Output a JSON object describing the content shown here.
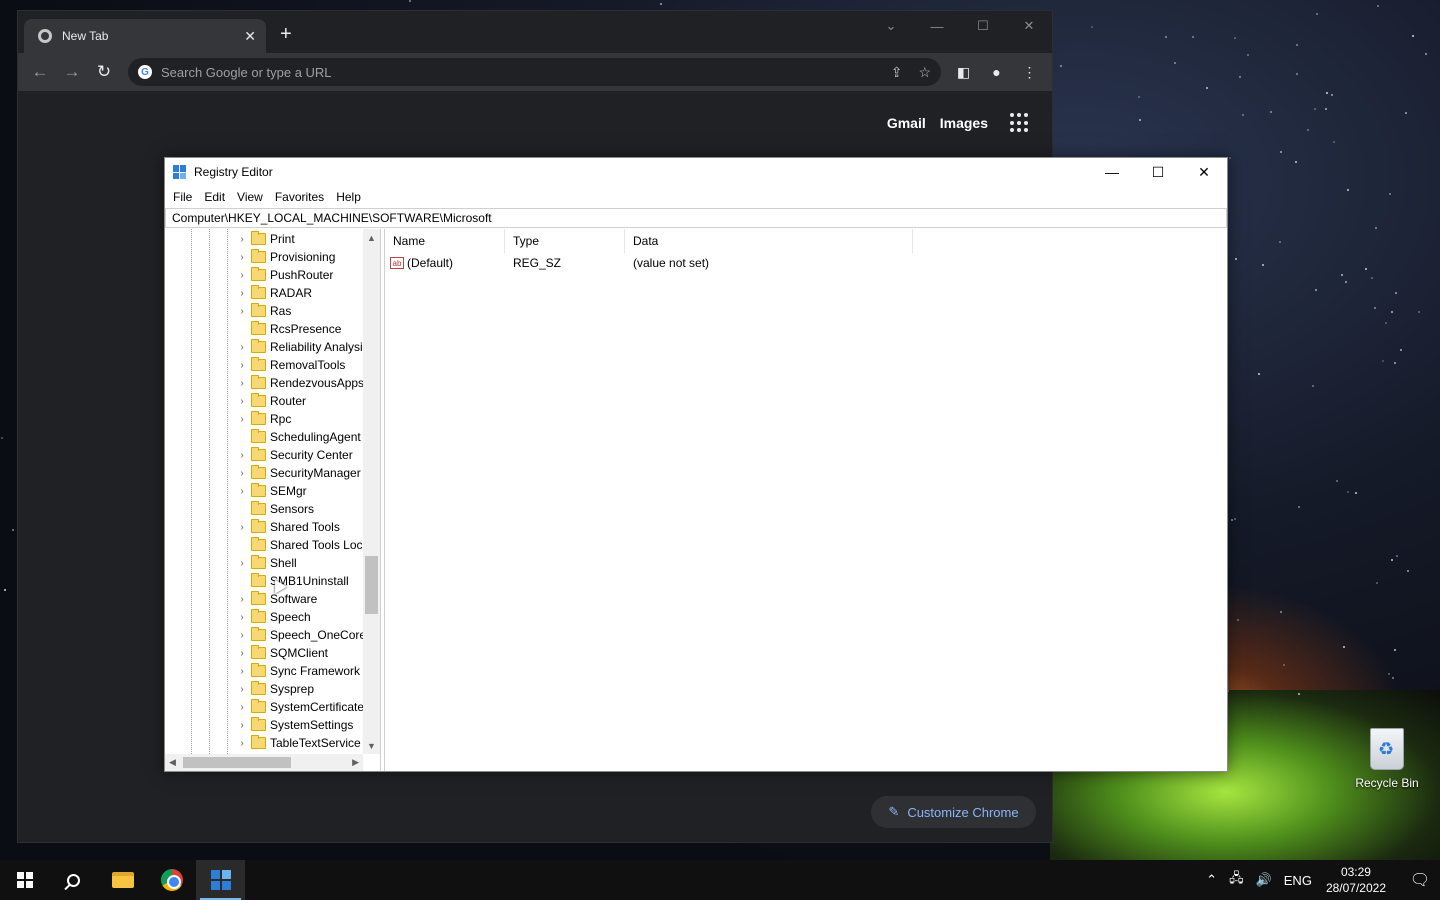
{
  "desktop": {
    "recycle_bin_label": "Recycle Bin"
  },
  "chrome": {
    "tab_title": "New Tab",
    "tab_close": "✕",
    "new_tab": "+",
    "omnibox_placeholder": "Search Google or type a URL",
    "top_links": [
      "Gmail",
      "Images"
    ],
    "customize_label": "Customize Chrome",
    "icons": {
      "favicon": "chrome-favicon-icon",
      "back": "arrow-left-icon",
      "forward": "arrow-right-icon",
      "reload": "reload-icon",
      "share": "share-icon",
      "bookmark": "star-icon",
      "side_panel": "side-panel-icon",
      "profile": "profile-icon",
      "menu": "kebab-menu-icon",
      "apps": "apps-grid-icon",
      "customize": "pencil-icon"
    }
  },
  "regedit": {
    "title": "Registry Editor",
    "menu": [
      "File",
      "Edit",
      "View",
      "Favorites",
      "Help"
    ],
    "address": "Computer\\HKEY_LOCAL_MACHINE\\SOFTWARE\\Microsoft",
    "tree_items": [
      {
        "label": "Print",
        "expandable": true
      },
      {
        "label": "Provisioning",
        "expandable": true
      },
      {
        "label": "PushRouter",
        "expandable": true
      },
      {
        "label": "RADAR",
        "expandable": true
      },
      {
        "label": "Ras",
        "expandable": true
      },
      {
        "label": "RcsPresence",
        "expandable": false
      },
      {
        "label": "Reliability Analysi",
        "expandable": true
      },
      {
        "label": "RemovalTools",
        "expandable": true
      },
      {
        "label": "RendezvousApps",
        "expandable": true
      },
      {
        "label": "Router",
        "expandable": true
      },
      {
        "label": "Rpc",
        "expandable": true
      },
      {
        "label": "SchedulingAgent",
        "expandable": false
      },
      {
        "label": "Security Center",
        "expandable": true
      },
      {
        "label": "SecurityManager",
        "expandable": true
      },
      {
        "label": "SEMgr",
        "expandable": true
      },
      {
        "label": "Sensors",
        "expandable": false
      },
      {
        "label": "Shared Tools",
        "expandable": true
      },
      {
        "label": "Shared Tools Loca",
        "expandable": false
      },
      {
        "label": "Shell",
        "expandable": true
      },
      {
        "label": "SMB1Uninstall",
        "expandable": false
      },
      {
        "label": "Software",
        "expandable": true
      },
      {
        "label": "Speech",
        "expandable": true
      },
      {
        "label": "Speech_OneCore",
        "expandable": true
      },
      {
        "label": "SQMClient",
        "expandable": true
      },
      {
        "label": "Sync Framework",
        "expandable": true
      },
      {
        "label": "Sysprep",
        "expandable": true
      },
      {
        "label": "SystemCertificate",
        "expandable": true
      },
      {
        "label": "SystemSettings",
        "expandable": true
      },
      {
        "label": "TableTextService",
        "expandable": true
      }
    ],
    "columns": [
      "Name",
      "Type",
      "Data"
    ],
    "values": [
      {
        "name": "(Default)",
        "type": "REG_SZ",
        "data": "(value not set)",
        "icon": "ab"
      }
    ]
  },
  "taskbar": {
    "language": "ENG",
    "time": "03:29",
    "date": "28/07/2022"
  }
}
